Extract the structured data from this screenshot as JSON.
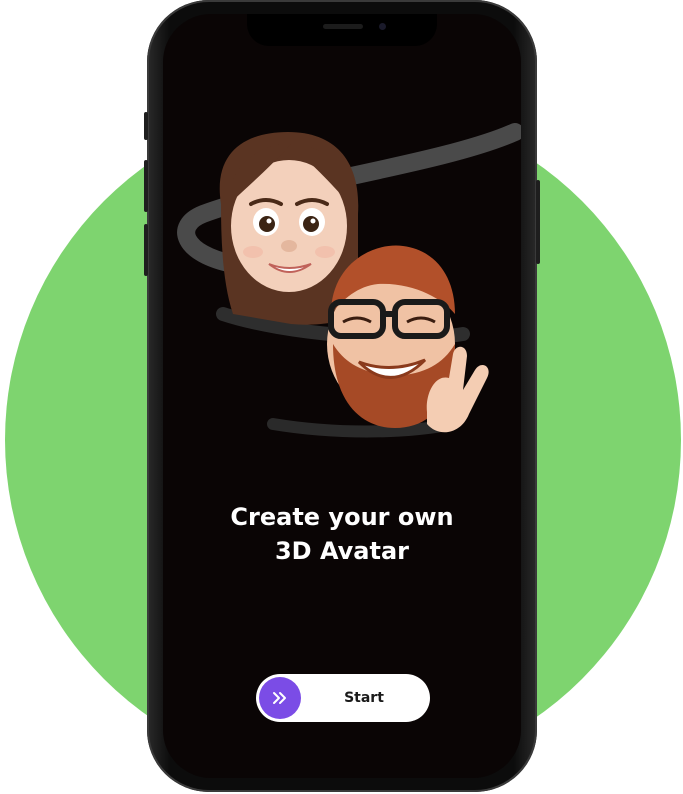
{
  "onboarding": {
    "headline_line1": "Create your own",
    "headline_line2": "3D Avatar",
    "start_label": "Start",
    "start_icon": "double-chevron-right-icon"
  },
  "colors": {
    "background_circle": "#7ed46f",
    "screen_background": "#0a0505",
    "accent": "#7b4ce6",
    "headline_text": "#ffffff",
    "button_background": "#ffffff"
  }
}
